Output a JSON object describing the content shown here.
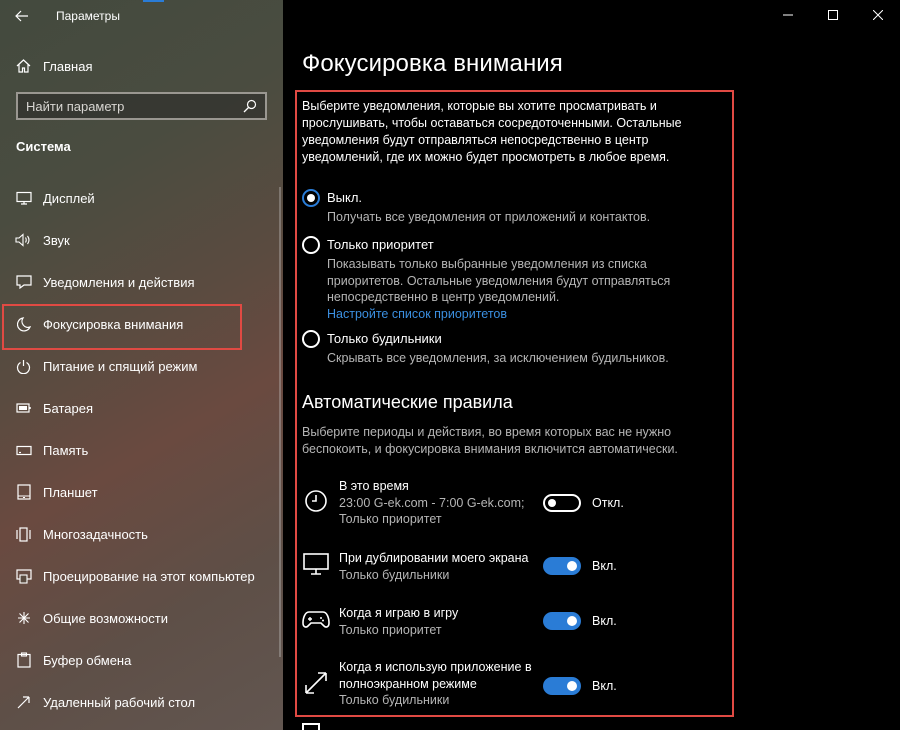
{
  "window": {
    "title": "Параметры"
  },
  "sidebar": {
    "home_label": "Главная",
    "search_placeholder": "Найти параметр",
    "section_title": "Система",
    "items": [
      {
        "label": "Дисплей",
        "icon": "display-icon"
      },
      {
        "label": "Звук",
        "icon": "speaker-icon"
      },
      {
        "label": "Уведомления и действия",
        "icon": "notifications-icon"
      },
      {
        "label": "Фокусировка внимания",
        "icon": "moon-icon",
        "selected": true
      },
      {
        "label": "Питание и спящий режим",
        "icon": "power-icon"
      },
      {
        "label": "Батарея",
        "icon": "battery-icon"
      },
      {
        "label": "Память",
        "icon": "storage-icon"
      },
      {
        "label": "Планшет",
        "icon": "tablet-icon"
      },
      {
        "label": "Многозадачность",
        "icon": "multitasking-icon"
      },
      {
        "label": "Проецирование на этот компьютер",
        "icon": "projecting-icon"
      },
      {
        "label": "Общие возможности",
        "icon": "shared-experiences-icon"
      },
      {
        "label": "Буфер обмена",
        "icon": "clipboard-icon"
      },
      {
        "label": "Удаленный рабочий стол",
        "icon": "remote-desktop-icon"
      }
    ]
  },
  "main": {
    "title": "Фокусировка внимания",
    "intro": "Выберите уведомления, которые вы хотите просматривать и прослушивать, чтобы оставаться сосредоточенными. Остальные уведомления будут отправляться непосредственно в центр уведомлений, где их можно будет просмотреть в любое время.",
    "options": [
      {
        "label": "Выкл.",
        "desc": "Получать все уведомления от приложений и контактов.",
        "selected": true
      },
      {
        "label": "Только приоритет",
        "desc": "Показывать только выбранные уведомления из списка приоритетов. Остальные уведомления будут отправляться непосредственно в центр уведомлений.",
        "link": "Настройте список приоритетов",
        "selected": false
      },
      {
        "label": "Только будильники",
        "desc": "Скрывать все уведомления, за исключением будильников.",
        "selected": false
      }
    ],
    "auto_title": "Автоматические правила",
    "auto_desc": "Выберите периоды и действия, во время которых вас не нужно беспокоить, и фокусировка внимания включится автоматически.",
    "rules": [
      {
        "title": "В это время",
        "lines": [
          "23:00 G-ek.com - 7:00 G-ek.com;",
          "Только приоритет"
        ],
        "state": "Откл.",
        "on": false,
        "icon": "clock-icon"
      },
      {
        "title": "При дублировании моего экрана",
        "lines": [
          "Только будильники"
        ],
        "state": "Вкл.",
        "on": true,
        "icon": "monitor-icon"
      },
      {
        "title": "Когда я играю в игру",
        "lines": [
          "Только приоритет"
        ],
        "state": "Вкл.",
        "on": true,
        "icon": "gamepad-icon"
      },
      {
        "title": "Когда я использую приложение в полноэкранном режиме",
        "lines": [
          "Только будильники"
        ],
        "state": "Вкл.",
        "on": true,
        "icon": "fullscreen-icon"
      }
    ]
  },
  "colors": {
    "accent": "#2a7cd6",
    "highlight_frame": "#e04a43",
    "link": "#3b8fe0"
  }
}
